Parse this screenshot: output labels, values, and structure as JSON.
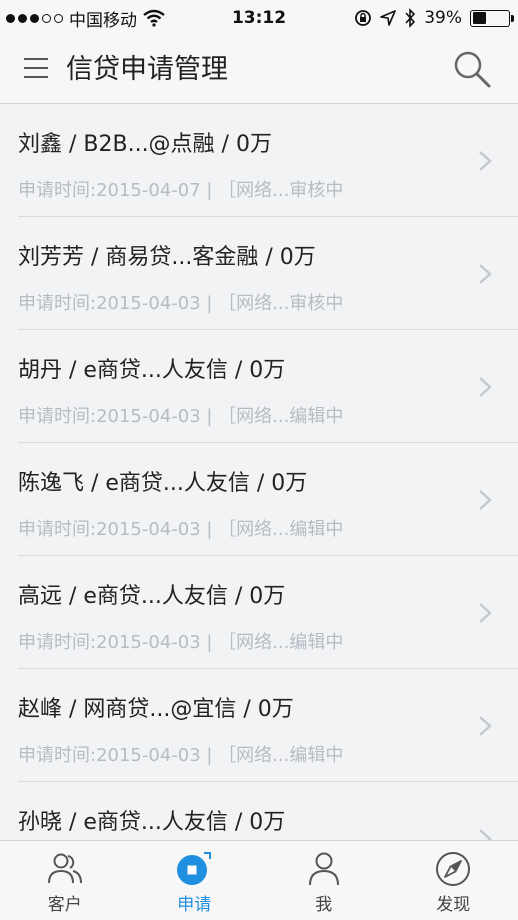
{
  "status_bar": {
    "carrier": "中国移动",
    "time": "13:12",
    "battery": "39%",
    "battery_level": 0.39
  },
  "header": {
    "title": "信贷申请管理"
  },
  "applications": [
    {
      "title": "刘鑫 / B2B...@点融 / 0万",
      "subtitle": "申请时间:2015-04-07 | ［网络...审核中"
    },
    {
      "title": "刘芳芳 / 商易贷...客金融 / 0万",
      "subtitle": "申请时间:2015-04-03 | ［网络...审核中"
    },
    {
      "title": "胡丹 / e商贷...人友信 / 0万",
      "subtitle": "申请时间:2015-04-03 | ［网络...编辑中"
    },
    {
      "title": "陈逸飞 / e商贷...人友信 / 0万",
      "subtitle": "申请时间:2015-04-03 | ［网络...编辑中"
    },
    {
      "title": "高远 / e商贷...人友信 / 0万",
      "subtitle": "申请时间:2015-04-03 | ［网络...编辑中"
    },
    {
      "title": "赵峰 / 网商贷...@宜信 / 0万",
      "subtitle": "申请时间:2015-04-03 | ［网络...编辑中"
    },
    {
      "title": "孙晓 / e商贷...人友信 / 0万",
      "subtitle": ""
    }
  ],
  "tabs": [
    {
      "label": "客户",
      "icon": "customers-icon"
    },
    {
      "label": "申请",
      "icon": "apply-icon",
      "active": true
    },
    {
      "label": "我",
      "icon": "person-icon"
    },
    {
      "label": "发现",
      "icon": "compass-icon"
    }
  ],
  "colors": {
    "accent": "#1f8fe0",
    "subtitle": "#b7bcc4",
    "background": "#f2f3f5"
  }
}
